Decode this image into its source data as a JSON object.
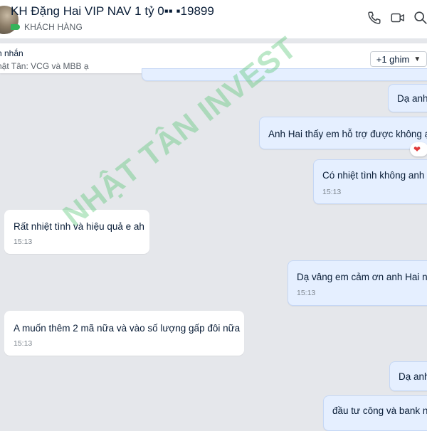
{
  "header": {
    "title": "KH Đặng Hai VIP NAV 1 tỷ 0▪▪ ▪19899",
    "tag_label": "KHÁCH HÀNG",
    "tag_color": "#35b35a",
    "icons": [
      "phone-icon",
      "video-icon",
      "search-icon"
    ]
  },
  "pinned": {
    "title": "n nhắn",
    "text": "hật Tân: VCG và MBB ạ",
    "button_label": "+1 ghim"
  },
  "messages": [
    {
      "direction": "out",
      "text": "Dạ anh",
      "time": ""
    },
    {
      "direction": "out",
      "text": "Anh Hai thấy em hỗ trợ được không ạ",
      "time": "",
      "reaction": "❤"
    },
    {
      "direction": "out",
      "text": "Có nhiệt tình không anh",
      "time": "15:13"
    },
    {
      "direction": "in",
      "text": "Rất nhiệt tình và hiệu quả e ah",
      "time": "15:13"
    },
    {
      "direction": "out",
      "text": "Dạ vâng em cảm ơn anh Hai nh",
      "time": "15:13"
    },
    {
      "direction": "in",
      "text": "A muốn thêm 2 mã nữa và vào số lượng gấp đôi nữa",
      "time": "15:13"
    },
    {
      "direction": "out",
      "text": "Dạ anh",
      "time": ""
    },
    {
      "direction": "out",
      "text": "đầu tư công và bank n",
      "time": ""
    }
  ],
  "watermark": "NHẬT TÂN INVEST",
  "colors": {
    "outgoing_bubble": "#e5efff",
    "incoming_bubble": "#ffffff",
    "background": "#e5e7eb",
    "heart": "#e03a3a"
  }
}
